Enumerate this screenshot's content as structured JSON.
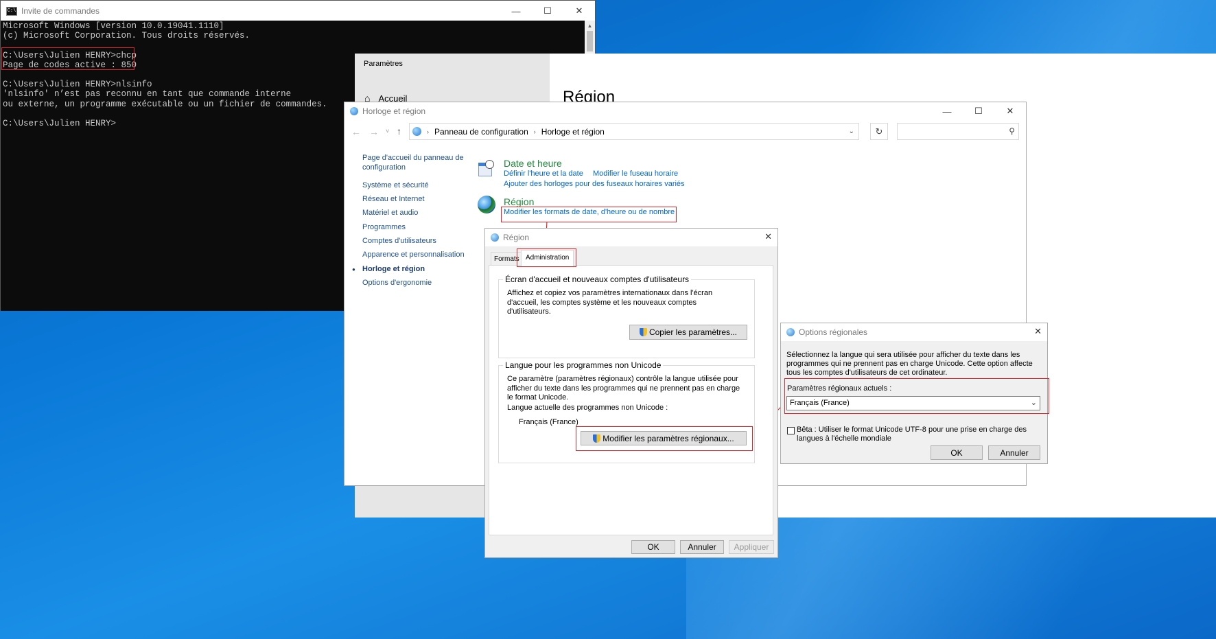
{
  "cmd": {
    "title": "Invite de commandes",
    "lines": [
      "Microsoft Windows [version 10.0.19041.1110]",
      "(c) Microsoft Corporation. Tous droits réservés.",
      "",
      "C:\\Users\\Julien HENRY>chcp",
      "Page de codes active : 850",
      "",
      "C:\\Users\\Julien HENRY>nlsinfo",
      "'nlsinfo' n’est pas reconnu en tant que commande interne",
      "ou externe, un programme exécutable ou un fichier de commandes.",
      "",
      "C:\\Users\\Julien HENRY>"
    ]
  },
  "settings": {
    "title": "Paramètres",
    "home": "Accueil",
    "heading": "Région"
  },
  "control_panel": {
    "title": "Horloge et région",
    "breadcrumb": [
      "Panneau de configuration",
      "Horloge et région"
    ],
    "search_placeholder": "",
    "sidebar": [
      {
        "label": "Page d'accueil du panneau de configuration",
        "active": false
      },
      {
        "label": "Système et sécurité",
        "active": false
      },
      {
        "label": "Réseau et Internet",
        "active": false
      },
      {
        "label": "Matériel et audio",
        "active": false
      },
      {
        "label": "Programmes",
        "active": false
      },
      {
        "label": "Comptes d'utilisateurs",
        "active": false
      },
      {
        "label": "Apparence et personnalisation",
        "active": false
      },
      {
        "label": "Horloge et région",
        "active": true
      },
      {
        "label": "Options d'ergonomie",
        "active": false
      }
    ],
    "date_time": {
      "title": "Date et heure",
      "link1": "Définir l'heure et la date",
      "link2": "Modifier le fuseau horaire",
      "link3": "Ajouter des horloges pour des fuseaux horaires variés"
    },
    "region": {
      "title": "Région",
      "link1": "Modifier les formats de date, d'heure ou de nombre"
    }
  },
  "region_dialog": {
    "title": "Région",
    "tabs": [
      "Formats",
      "Administration"
    ],
    "welcome_group": {
      "title": "Écran d'accueil et nouveaux comptes d'utilisateurs",
      "text": "Affichez et copiez vos paramètres internationaux dans l'écran d'accueil, les comptes système et les nouveaux comptes d'utilisateurs.",
      "button": "Copier les paramètres..."
    },
    "unicode_group": {
      "title": "Langue pour les programmes non Unicode",
      "text": "Ce paramètre (paramètres régionaux) contrôle la langue utilisée pour afficher du texte dans les programmes qui ne prennent pas en charge le format Unicode.",
      "current_label": "Langue actuelle des programmes non Unicode :",
      "current_value": "Français (France)",
      "button": "Modifier les paramètres régionaux..."
    },
    "ok": "OK",
    "cancel": "Annuler",
    "apply": "Appliquer"
  },
  "regional_options": {
    "title": "Options régionales",
    "description": "Sélectionnez la langue qui sera utilisée pour afficher du texte dans les programmes qui ne prennent pas en charge Unicode. Cette option affecte tous les comptes d'utilisateurs de cet ordinateur.",
    "current_label": "Paramètres régionaux actuels :",
    "current_value": "Français (France)",
    "beta_label": "Bêta : Utiliser le format Unicode UTF-8 pour une prise en charge des langues à l'échelle mondiale",
    "beta_checked": false,
    "ok": "OK",
    "cancel": "Annuler"
  }
}
